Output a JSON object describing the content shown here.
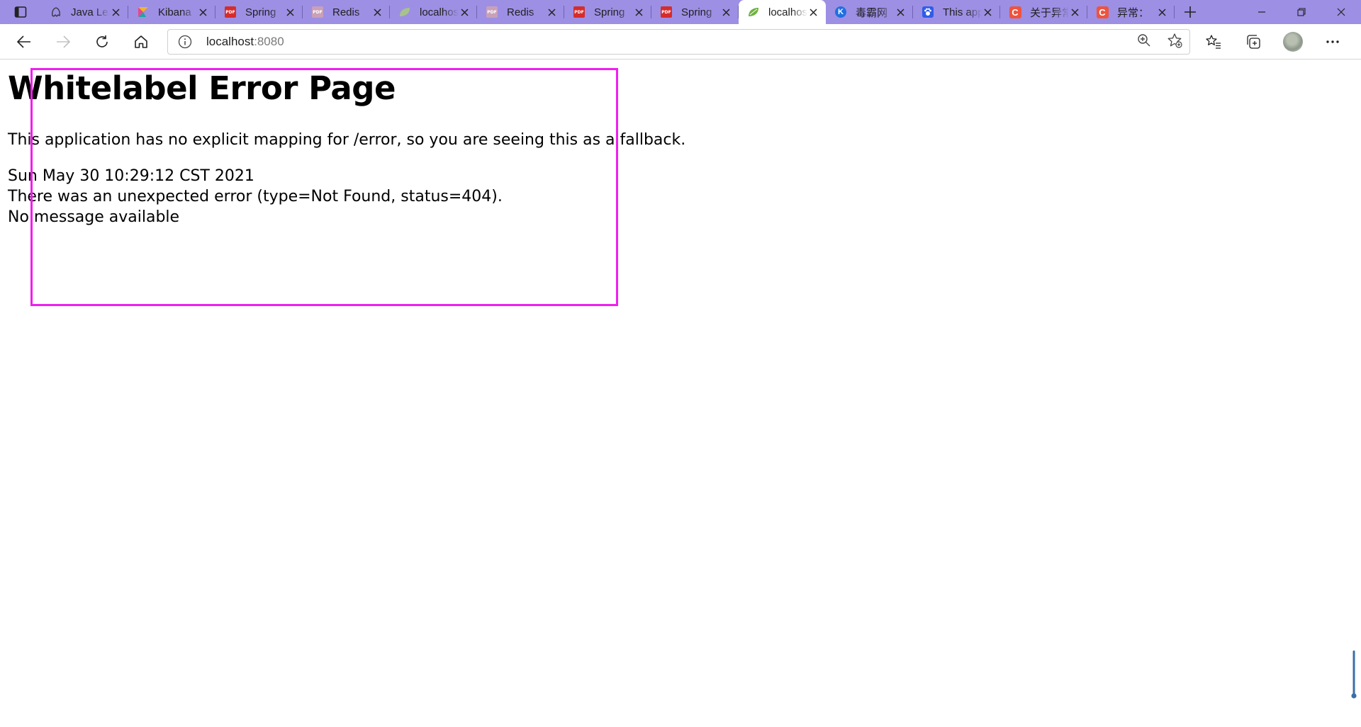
{
  "browser": {
    "tabs": [
      {
        "title": "Java Learning",
        "icon": "github-octocat-icon",
        "active": false
      },
      {
        "title": "Kibana",
        "icon": "kibana-icon",
        "active": false
      },
      {
        "title": "Spring",
        "icon": "pdf-icon",
        "active": false
      },
      {
        "title": "Redis",
        "icon": "pdf-icon",
        "active": false
      },
      {
        "title": "localhost",
        "icon": "spring-leaf-icon",
        "active": false
      },
      {
        "title": "Redis",
        "icon": "pdf-icon",
        "active": false
      },
      {
        "title": "Spring",
        "icon": "pdf-icon",
        "active": false
      },
      {
        "title": "Spring",
        "icon": "pdf-icon",
        "active": false
      },
      {
        "title": "localhost",
        "icon": "spring-leaf-icon",
        "active": true
      },
      {
        "title": "毒霸网",
        "icon": "k-icon",
        "active": false
      },
      {
        "title": "This app",
        "icon": "baidu-paw-icon",
        "active": false
      },
      {
        "title": "关于异常",
        "icon": "csdn-icon",
        "active": false
      },
      {
        "title": "异常：",
        "icon": "csdn-icon",
        "active": false
      }
    ],
    "address": {
      "host": "localhost",
      "port": ":8080"
    },
    "accent_color": "#9d8fe4"
  },
  "page": {
    "title": "Whitelabel Error Page",
    "message": "This application has no explicit mapping for /error, so you are seeing this as a fallback.",
    "timestamp": "Sun May 30 10:29:12 CST 2021",
    "error": "There was an unexpected error (type=Not Found, status=404).",
    "detail": "No message available"
  },
  "annotation": {
    "color": "#f01ef0"
  }
}
